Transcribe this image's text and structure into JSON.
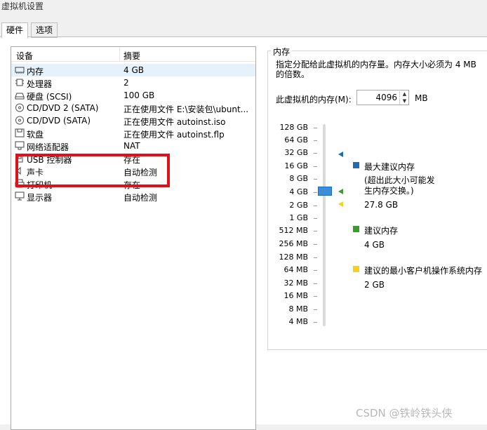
{
  "window": {
    "title": "虚拟机设置"
  },
  "tabs": [
    {
      "label": "硬件"
    },
    {
      "label": "选项"
    }
  ],
  "devices": {
    "header": {
      "device": "设备",
      "summary": "摘要"
    },
    "rows": [
      {
        "icon": "memory-icon",
        "name": "内存",
        "summary": "4 GB"
      },
      {
        "icon": "processor-icon",
        "name": "处理器",
        "summary": "2"
      },
      {
        "icon": "hard-disk-icon",
        "name": "硬盘 (SCSI)",
        "summary": "100 GB"
      },
      {
        "icon": "cd-dvd-icon",
        "name": "CD/DVD 2 (SATA)",
        "summary": "正在使用文件 E:\\安装包\\ubunt..."
      },
      {
        "icon": "cd-dvd-icon",
        "name": "CD/DVD (SATA)",
        "summary": "正在使用文件 autoinst.iso"
      },
      {
        "icon": "floppy-icon",
        "name": "软盘",
        "summary": "正在使用文件 autoinst.flp"
      },
      {
        "icon": "network-adapter-icon",
        "name": "网络适配器",
        "summary": "NAT"
      },
      {
        "icon": "usb-icon",
        "name": "USB 控制器",
        "summary": "存在"
      },
      {
        "icon": "sound-card-icon",
        "name": "声卡",
        "summary": "自动检测"
      },
      {
        "icon": "printer-icon",
        "name": "打印机",
        "summary": "存在"
      },
      {
        "icon": "display-icon",
        "name": "显示器",
        "summary": "自动检测"
      }
    ]
  },
  "memory": {
    "group_title": "内存",
    "description": "指定分配给此虚拟机的内存量。内存大小必须为 4 MB 的倍数。",
    "field_label": "此虚拟机的内存(M):",
    "value": "4096",
    "unit": "MB",
    "scale": [
      "128 GB",
      "64 GB",
      "32 GB",
      "16 GB",
      "8 GB",
      "4 GB",
      "2 GB",
      "1 GB",
      "512 MB",
      "256 MB",
      "128 MB",
      "64 MB",
      "32 MB",
      "16 MB",
      "8 MB",
      "4 MB"
    ],
    "max_recommended": {
      "title": "最大建议内存",
      "note": "(超出此大小可能发生内存交换。)",
      "value": "27.8 GB",
      "color": "#1c6cb8"
    },
    "recommended": {
      "title": "建议内存",
      "value": "4 GB",
      "color": "#3c9a2e"
    },
    "guest_min": {
      "title": "建议的最小客户机操作系统内存",
      "value": "2 GB",
      "color": "#f2d21b"
    }
  },
  "watermark": "CSDN @铁岭铁头侠"
}
